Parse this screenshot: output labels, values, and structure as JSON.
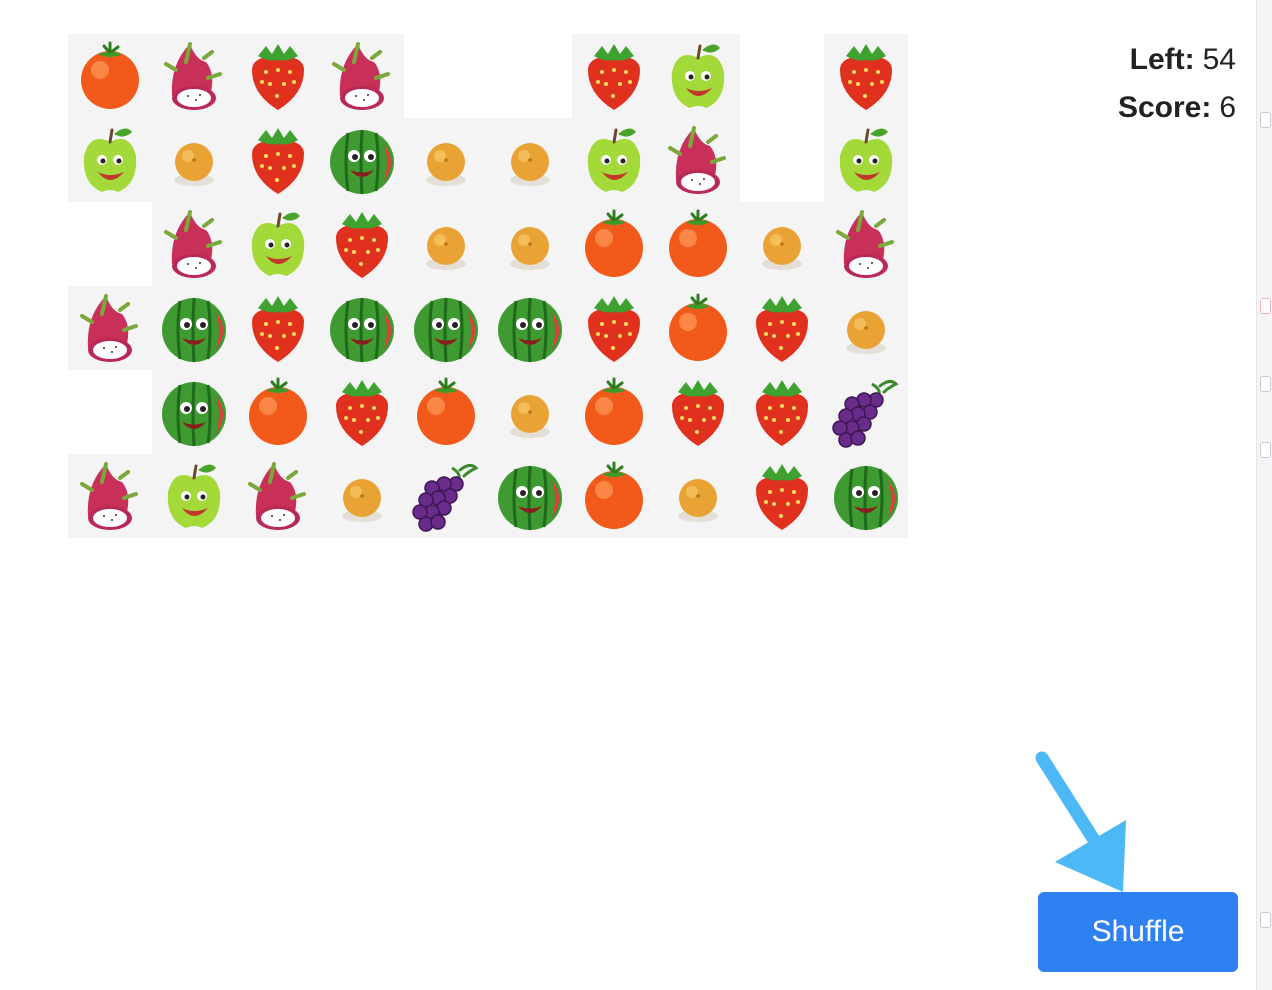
{
  "stats": {
    "left_label": "Left:",
    "left_value": "54",
    "score_label": "Score:",
    "score_value": "6"
  },
  "shuffle": {
    "label": "Shuffle"
  },
  "board": {
    "columns": 10,
    "rows": 6,
    "tiles": [
      [
        "tomato",
        "dragonfruit",
        "strawberry",
        "dragonfruit",
        null,
        null,
        "strawberry",
        "apple",
        null,
        "strawberry"
      ],
      [
        "apple",
        "orange",
        "strawberry",
        "watermelon",
        "orange",
        "orange",
        "apple",
        "dragonfruit",
        null,
        "apple"
      ],
      [
        null,
        "dragonfruit",
        "apple",
        "strawberry",
        "orange",
        "orange",
        "tomato",
        "tomato",
        "orange",
        "dragonfruit"
      ],
      [
        "dragonfruit",
        "watermelon",
        "strawberry",
        "watermelon",
        "watermelon",
        "watermelon",
        "strawberry",
        "tomato",
        "strawberry",
        "orange"
      ],
      [
        null,
        "watermelon",
        "tomato",
        "strawberry",
        "tomato",
        "orange",
        "tomato",
        "strawberry",
        "strawberry",
        "grapes"
      ],
      [
        "dragonfruit",
        "apple",
        "dragonfruit",
        "orange",
        "grapes",
        "watermelon",
        "tomato",
        "orange",
        "strawberry",
        "watermelon"
      ]
    ],
    "tile_icons": {
      "tomato": "tomato-icon",
      "dragonfruit": "dragonfruit-icon",
      "strawberry": "strawberry-icon",
      "apple": "green-apple-icon",
      "orange": "orange-icon",
      "watermelon": "watermelon-icon",
      "grapes": "grapes-icon"
    }
  },
  "colors": {
    "button": "#2f80f0",
    "pointer_arrow": "#4cb8f5",
    "tile_background": "#f4f4f4"
  }
}
